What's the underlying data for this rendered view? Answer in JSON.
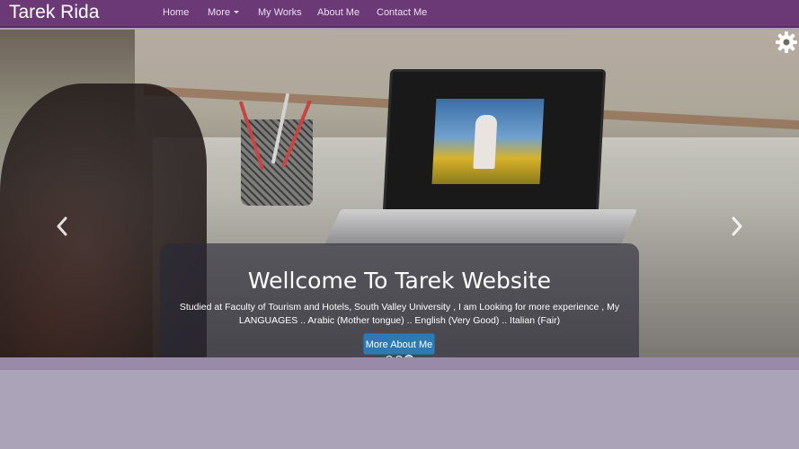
{
  "navbar": {
    "brand": "Tarek Rida",
    "items": [
      {
        "label": "Home"
      },
      {
        "label": "More",
        "has_dropdown": true
      },
      {
        "label": "My Works"
      },
      {
        "label": "About Me"
      },
      {
        "label": "Contact Me"
      }
    ]
  },
  "hero": {
    "title": "Wellcome To Tarek Website",
    "description": "Studied at Faculty of Tourism and Hotels, South Valley University , I am Looking for more experience , My LANGUAGES .. Arabic (Mother tongue) .. English (Very Good) .. Italian (Fair)",
    "button_label": "More About Me",
    "slides_total": 3,
    "active_slide": 3
  },
  "icons": {
    "settings": "gear-icon",
    "prev": "chevron-left-icon",
    "next": "chevron-right-icon",
    "dropdown": "caret-down-icon"
  },
  "colors": {
    "navbar": "#6b3a76",
    "button": "#2d79b4",
    "page_background": "#aba3b8",
    "active_indicator": "#b79cc7"
  }
}
